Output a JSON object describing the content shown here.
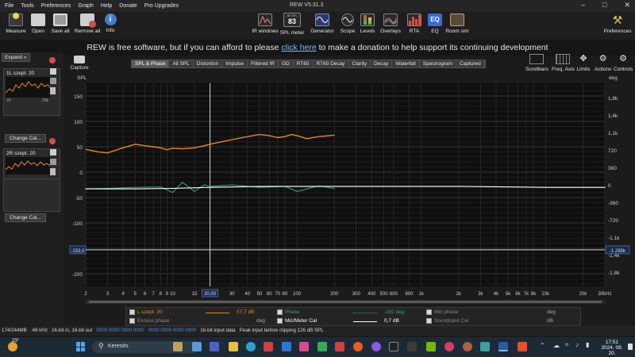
{
  "menu": [
    "File",
    "Tools",
    "Preferences",
    "Graph",
    "Help",
    "Donate",
    "Pro Upgrades"
  ],
  "window_title": "REW V5.31.3",
  "toolbar_left": [
    {
      "label": "Measure",
      "icon": "measure-icon",
      "color": "#f2d14a"
    },
    {
      "label": "Open",
      "icon": "folder-icon",
      "color": "#d8d8d8"
    },
    {
      "label": "Save all",
      "icon": "save-icon",
      "color": "#cfcfcf"
    },
    {
      "label": "Remove all",
      "icon": "remove-icon",
      "color": "#d94a4a"
    },
    {
      "label": "Info",
      "icon": "info-icon",
      "color": "#6fa8e8"
    }
  ],
  "toolbar_mid": [
    {
      "label": "IR windows",
      "icon": "ir-windows-icon",
      "color": "#c97a7a"
    },
    {
      "label": "SPL meter",
      "icon": "spl-meter-icon",
      "color": "#dddddd"
    },
    {
      "label": "Generator",
      "icon": "generator-icon",
      "color": "#6f8fd8"
    },
    {
      "label": "Scope",
      "icon": "scope-icon",
      "color": "#dddddd"
    },
    {
      "label": "Levels",
      "icon": "levels-icon",
      "color": "#d94a4a"
    },
    {
      "label": "Overlays",
      "icon": "overlays-icon",
      "color": "#b0b0b0"
    },
    {
      "label": "RTA",
      "icon": "rta-icon",
      "color": "#d94a4a"
    },
    {
      "label": "EQ",
      "icon": "eq-icon",
      "color": "#4a7fd8"
    },
    {
      "label": "Room sim",
      "icon": "room-sim-icon",
      "color": "#c0a070"
    }
  ],
  "spl_meter_value": "83",
  "spl_meter_caption": "dB SPL",
  "preferences_label": "Preferences",
  "banner": {
    "before": "REW is free software, but if you can afford to please ",
    "link": "click here",
    "after": " to make a donation to help support its continuing development"
  },
  "expand_label": "Expand",
  "measurements": [
    {
      "name": "1L szept. 20",
      "tick_lo": "20",
      "tick_hi": "20k",
      "change_cal": "Change Cal..."
    },
    {
      "name": "2R szept. 20",
      "tick_lo": "20",
      "tick_hi": "20k",
      "change_cal": "Change Cal..."
    }
  ],
  "capture_label": "Capture",
  "tabs": [
    "SPL & Phase",
    "All SPL",
    "Distortion",
    "Impulse",
    "Filtered IR",
    "GD",
    "RT60",
    "RT60 Decay",
    "Clarity",
    "Decay",
    "Waterfall",
    "Spectrogram",
    "Captured"
  ],
  "active_tab": "SPL & Phase",
  "right_controls": [
    "Scrollbars",
    "Freq. Axis",
    "Limits",
    "Actions",
    "Controls"
  ],
  "axis_left_label": "SPL",
  "axis_right_label": "deg",
  "cursor_left_value": "-153,0",
  "cursor_right_value": "-1.285k",
  "cursor_freq": "20,00",
  "chart_data": {
    "type": "line",
    "x_scale": "log",
    "xlim": [
      2,
      30000
    ],
    "ylim": [
      -225,
      175
    ],
    "x_ticks": [
      "2",
      "3",
      "4",
      "5",
      "6",
      "7",
      "8",
      "9",
      "10",
      "15",
      "20",
      "30",
      "40",
      "50",
      "60",
      "70",
      "80",
      "100",
      "200",
      "300",
      "400",
      "500",
      "600",
      "800",
      "1k",
      "2k",
      "3k",
      "4k",
      "5k",
      "6k",
      "7k",
      "8k",
      "10k",
      "20k",
      "30kHz"
    ],
    "y_ticks": [
      "150",
      "100",
      "50",
      "0",
      "-50",
      "-100",
      "-150",
      "-200"
    ],
    "y2_ticks": [
      "1,8k",
      "1,4k",
      "1,1k",
      "720",
      "360",
      "0",
      "-360",
      "-720",
      "-1,1k",
      "-1,4k",
      "-1,8k"
    ],
    "grid": true,
    "series": [
      {
        "name": "L szept. 20",
        "color": "#e5891c",
        "x": [
          2,
          2.5,
          3,
          4,
          5,
          6,
          7,
          8,
          9,
          10,
          12,
          15,
          18,
          20,
          25,
          30,
          40,
          50,
          60,
          70,
          80,
          90,
          100,
          120,
          150,
          200
        ],
        "y": [
          45,
          40,
          38,
          48,
          55,
          52,
          50,
          48,
          44,
          47,
          46,
          48,
          52,
          55,
          60,
          64,
          70,
          74,
          72,
          68,
          70,
          74,
          72,
          66,
          70,
          73
        ]
      },
      {
        "name": "Excess phase",
        "color": "#2fa07a",
        "x": [
          2,
          3,
          5,
          8,
          10,
          12,
          15,
          18,
          20,
          30,
          50,
          80,
          100,
          150,
          200
        ],
        "y": [
          -33,
          -32,
          -30,
          -29,
          -40,
          -20,
          -38,
          -25,
          -28,
          -25,
          -30,
          -28,
          -38,
          -27,
          -32
        ]
      },
      {
        "name": "Mic/Meter Cal",
        "color": "#ffffff",
        "x": [
          2,
          5,
          10,
          20,
          50,
          100,
          200,
          500,
          1000,
          2000,
          5000,
          10000,
          20000,
          30000
        ],
        "y": [
          -33,
          -33,
          -32,
          -30,
          -28,
          -28,
          -28,
          -28,
          -28,
          -28,
          -29,
          -30,
          -30,
          -30
        ]
      }
    ]
  },
  "legend": [
    {
      "name": "L szept. 20",
      "value": "57,7 dB",
      "unit": "",
      "color": "#e5891c"
    },
    {
      "name": "Excess phase",
      "value": "",
      "unit": "deg",
      "color": "#8a8a8a"
    },
    {
      "name": "Phase",
      "value": "-162 deg",
      "unit": "",
      "color": "#2fa07a"
    },
    {
      "name": "Mic/Meter Cal",
      "value": "0,7 dB",
      "unit": "",
      "color": "#ffffff"
    },
    {
      "name": "Min phase",
      "value": "",
      "unit": "deg",
      "color": "#8a8a8a"
    },
    {
      "name": "Soundcard Cal",
      "value": "",
      "unit": "dB",
      "color": "#8a8a8a"
    }
  ],
  "status": {
    "memory": "174/244MB",
    "rate": "48 kHz",
    "io": "16-bit in, 16-bit out",
    "bits_a": "0000 0000 0000 0000",
    "bits_b": "0000 0000 0000 0000",
    "input": "16-bit input data",
    "peak": "Peak input before clipping 126 dB SPL"
  },
  "taskbar": {
    "temp": "23°",
    "search": "Keresés",
    "time": "17:51",
    "date": "2024. 09. 20."
  }
}
